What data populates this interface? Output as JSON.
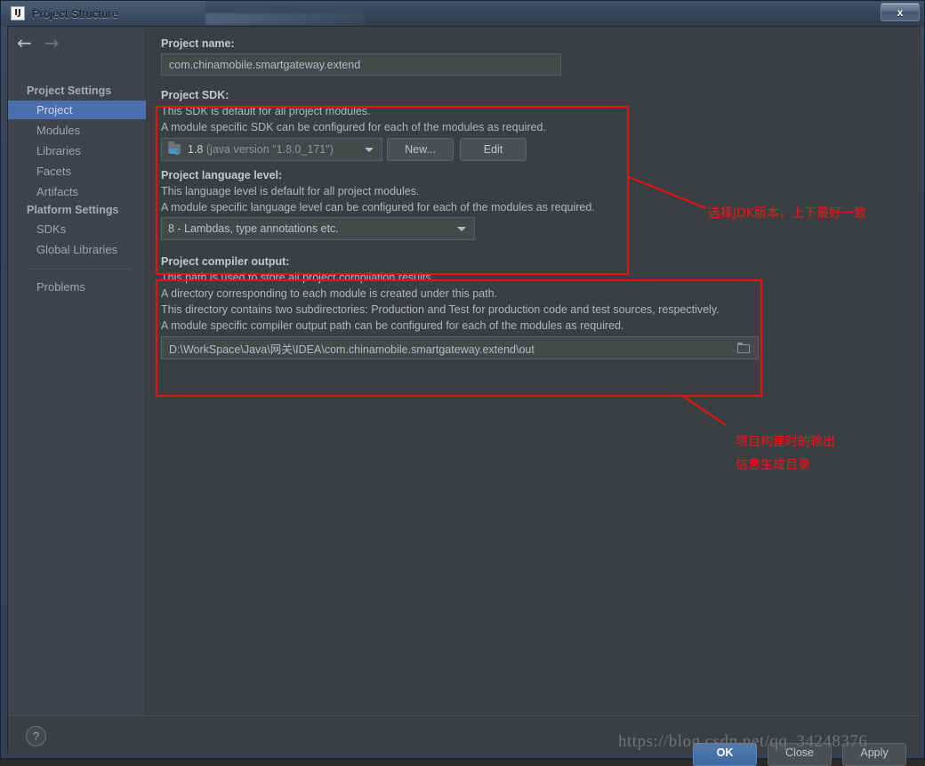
{
  "window": {
    "title": "Project Structure",
    "app_icon": "intellij-idea-icon",
    "close_label": "x"
  },
  "sidebar": {
    "back_arrow": "←",
    "forward_arrow": "→",
    "groups": [
      {
        "title": "Project Settings",
        "items": [
          {
            "label": "Project",
            "selected": true
          },
          {
            "label": "Modules",
            "selected": false
          },
          {
            "label": "Libraries",
            "selected": false
          },
          {
            "label": "Facets",
            "selected": false
          },
          {
            "label": "Artifacts",
            "selected": false
          }
        ]
      },
      {
        "title": "Platform Settings",
        "items": [
          {
            "label": "SDKs",
            "selected": false
          },
          {
            "label": "Global Libraries",
            "selected": false
          }
        ]
      }
    ],
    "problems": {
      "label": "Problems"
    }
  },
  "main": {
    "project_name": {
      "label": "Project name:",
      "value": "com.chinamobile.smartgateway.extend"
    },
    "project_sdk": {
      "label": "Project SDK:",
      "desc_line1": "This SDK is default for all project modules.",
      "desc_line2": "A module specific SDK can be configured for each of the modules as required.",
      "selected_major": "1.8",
      "selected_minor": "(java version \"1.8.0_171\")",
      "new_button": "New...",
      "edit_button": "Edit"
    },
    "language_level": {
      "label": "Project language level:",
      "desc_line1": "This language level is default for all project modules.",
      "desc_line2": "A module specific language level can be configured for each of the modules as required.",
      "selected": "8 - Lambdas, type annotations etc."
    },
    "compiler_output": {
      "label": "Project compiler output:",
      "desc_line1": "This path is used to store all project compilation results.",
      "desc_line2": "A directory corresponding to each module is created under this path.",
      "desc_line3": "This directory contains two subdirectories: Production and Test for production code and test sources, respectively.",
      "desc_line4": "A module specific compiler output path can be configured for each of the modules as required.",
      "value": "D:\\WorkSpace\\Java\\网关\\IDEA\\com.chinamobile.smartgateway.extend\\out",
      "browse_icon": "folder-browse-icon"
    }
  },
  "annotations": [
    {
      "text": "选择JDK版本，上下最好一致"
    },
    {
      "text": "项目构建时的输出"
    },
    {
      "text": "信息生成目录"
    }
  ],
  "footer": {
    "help_label": "?",
    "ok_label": "OK",
    "close_label": "Close",
    "apply_label": "Apply"
  },
  "watermark": "https://blog.csdn.net/qq_34248376",
  "colors": {
    "background": "#3c3f41",
    "sidebar": "#3f434c",
    "selection": "#4b6eaf",
    "annotation_red": "#ef0f0f",
    "titlebar": "#35425a"
  }
}
